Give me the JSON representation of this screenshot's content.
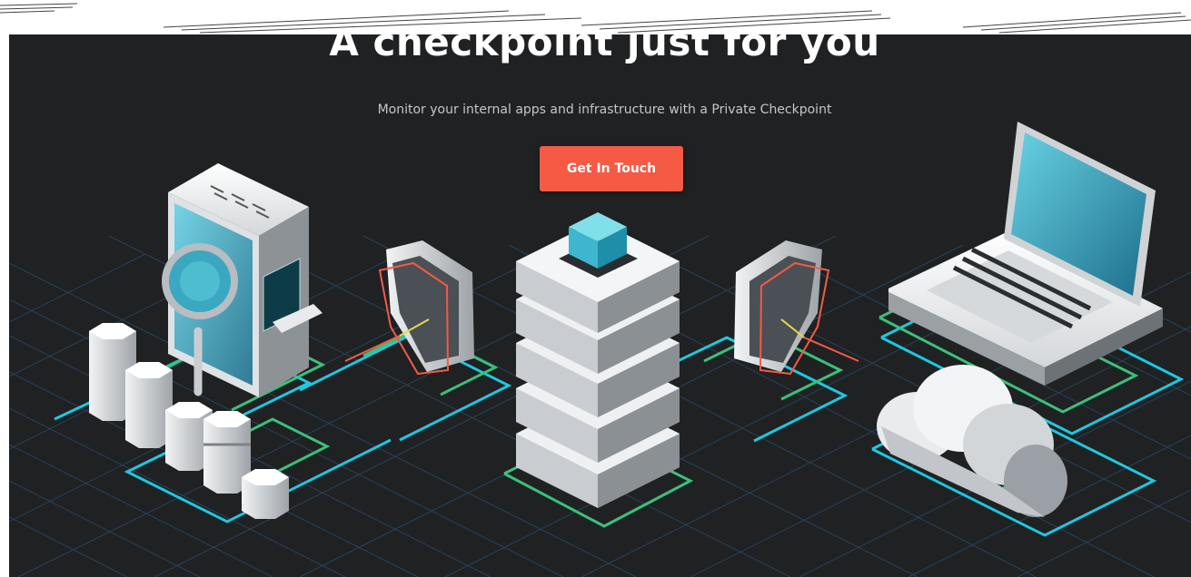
{
  "hero": {
    "title": "A checkpoint just for you",
    "subtitle": "Monitor your internal apps and infrastructure with a Private Checkpoint",
    "cta_label": "Get In Touch"
  },
  "colors": {
    "background": "#1f2123",
    "accent": "#f55a45",
    "grid_line": "#2c4a66",
    "trace_cyan": "#1ec8e0",
    "trace_green": "#3cc07a",
    "glass": "#3fb6cf"
  },
  "illustration": {
    "items": [
      "server-rack-icon",
      "magnifier-icon",
      "shield-icon",
      "database-stack-icon",
      "laptop-icon",
      "cloud-icon",
      "hexagon-cylinders-icon"
    ]
  }
}
